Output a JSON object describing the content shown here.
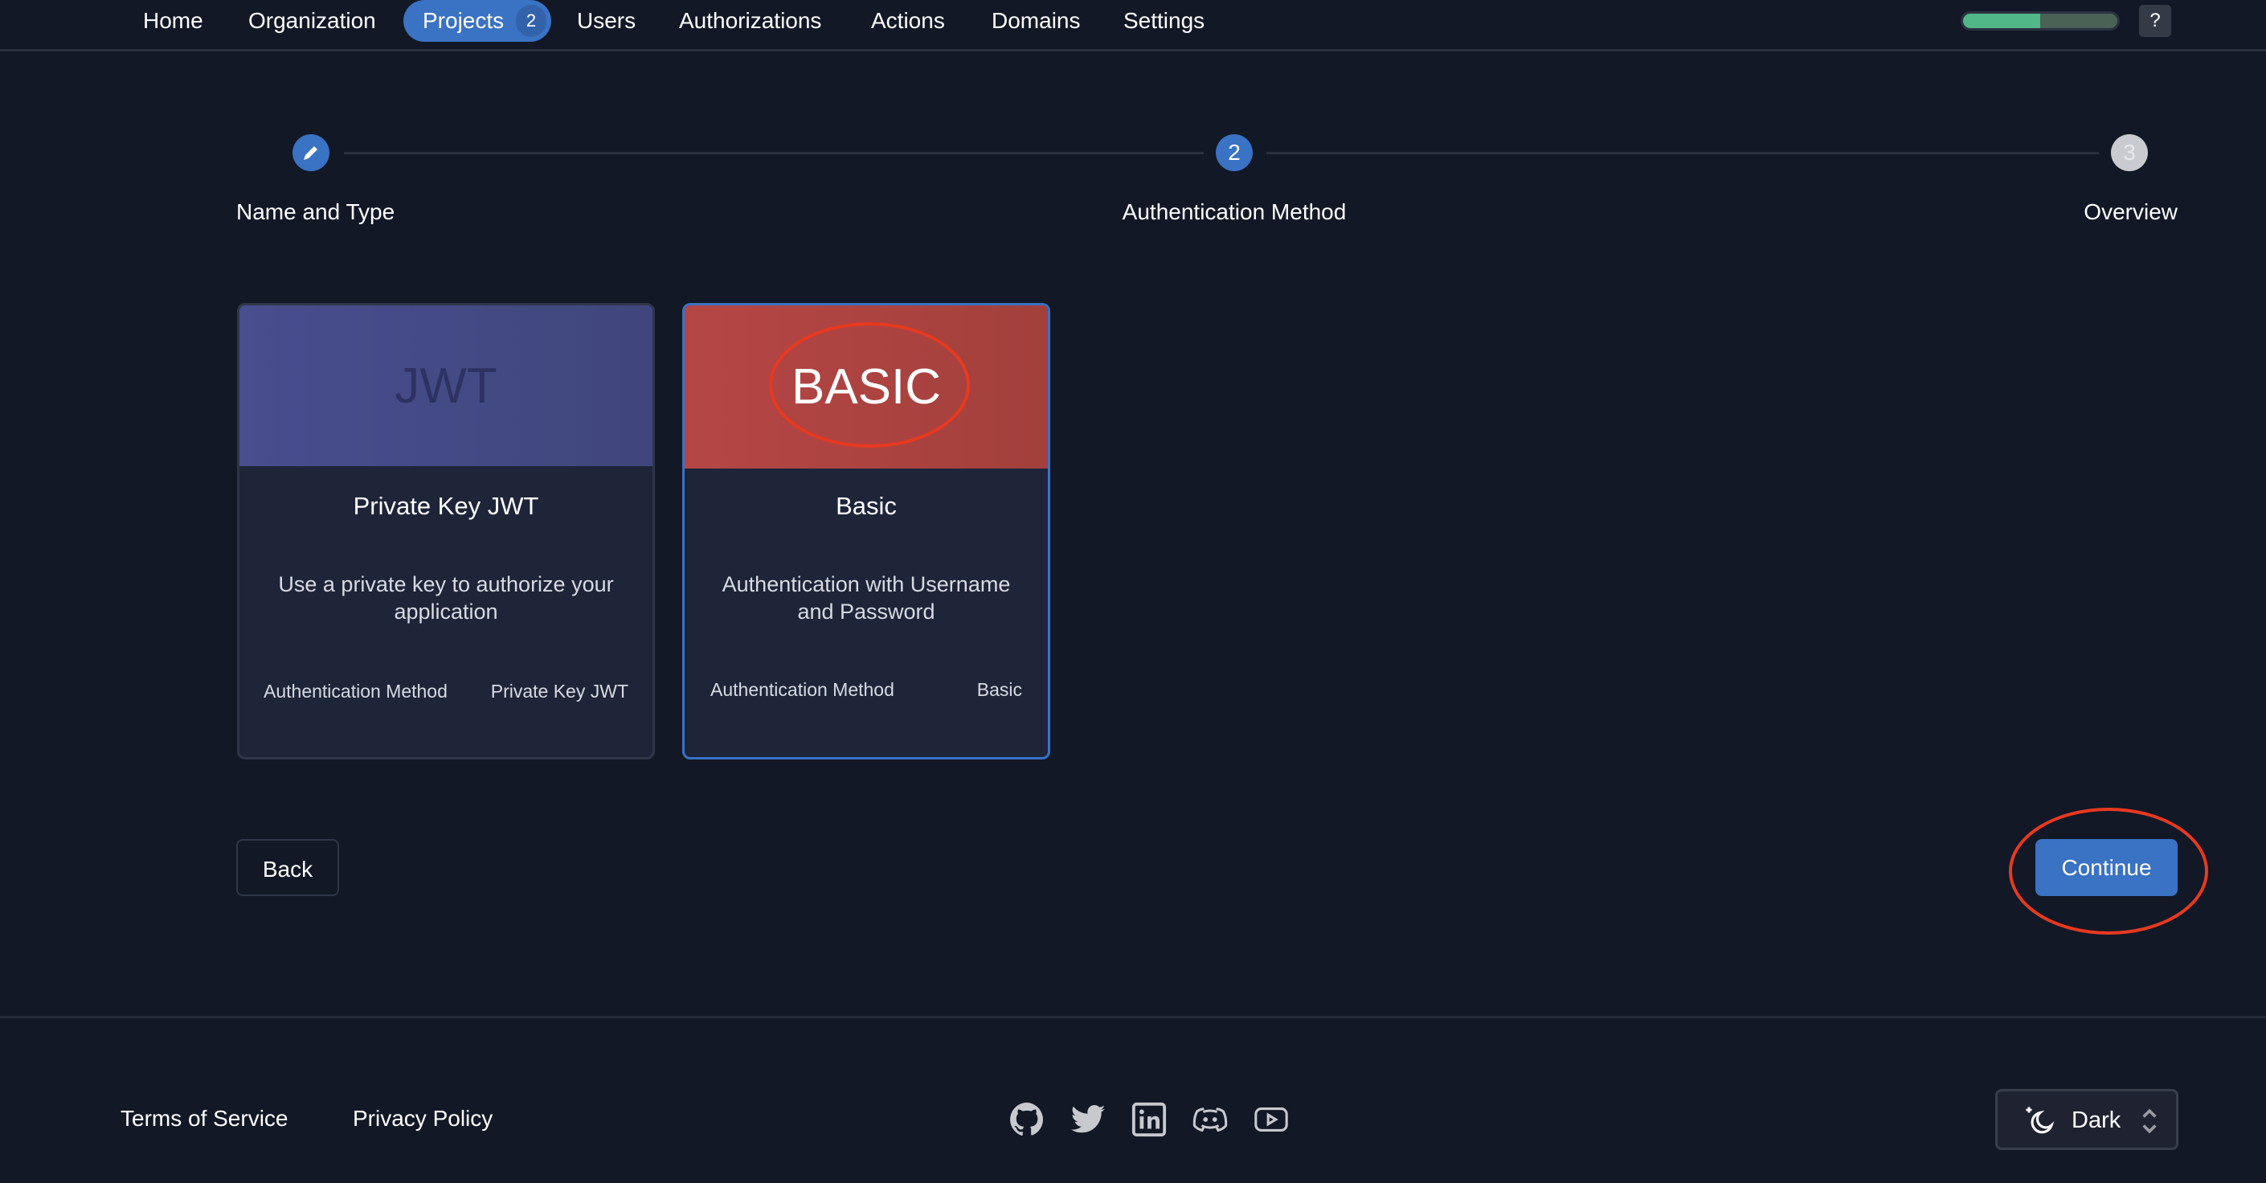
{
  "nav": {
    "items": [
      "Home",
      "Organization",
      "Projects",
      "Users",
      "Authorizations",
      "Actions",
      "Domains",
      "Settings"
    ],
    "projects_badge": "2",
    "progress_percent": 50,
    "help_label": "?"
  },
  "stepper": {
    "steps": [
      {
        "label": "Name and Type",
        "icon": "pencil-icon",
        "state": "done"
      },
      {
        "label": "Authentication Method",
        "number": "2",
        "state": "active"
      },
      {
        "label": "Overview",
        "number": "3",
        "state": "pending"
      }
    ]
  },
  "cards": [
    {
      "logo": "JWT",
      "title": "Private Key JWT",
      "description": "Use a private key to authorize your application",
      "meta_label": "Authentication Method",
      "meta_value": "Private Key JWT",
      "selected": false,
      "color": "#464c8c"
    },
    {
      "logo": "BASIC",
      "title": "Basic",
      "description": "Authentication with Username and Password",
      "meta_label": "Authentication Method",
      "meta_value": "Basic",
      "selected": true,
      "color": "#b44644"
    }
  ],
  "actions": {
    "back": "Back",
    "continue": "Continue"
  },
  "footer": {
    "terms": "Terms of Service",
    "privacy": "Privacy Policy",
    "socials": [
      "github-icon",
      "twitter-icon",
      "linkedin-icon",
      "discord-icon",
      "youtube-icon"
    ],
    "theme": "Dark"
  },
  "colors": {
    "accent": "#3a72c4",
    "background": "#121826",
    "annotation": "#e8391f"
  }
}
